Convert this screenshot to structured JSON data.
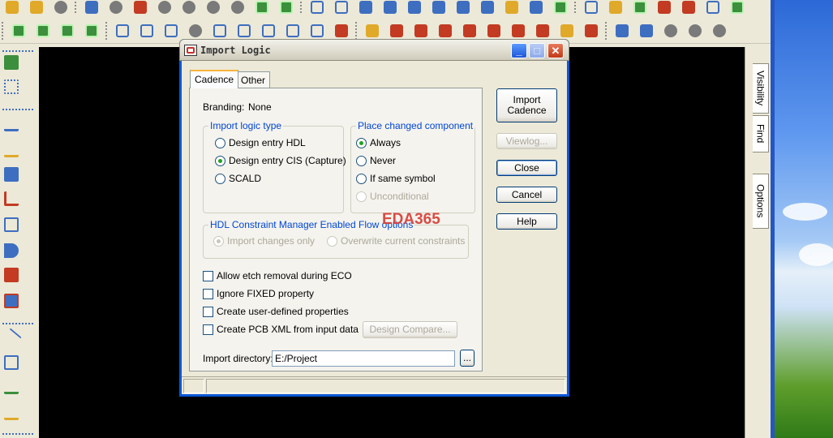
{
  "dialog": {
    "title": "Import Logic",
    "tabs": [
      "Cadence",
      "Other"
    ],
    "branding_label": "Branding:",
    "branding_value": "None",
    "import_logic_type": {
      "title": "Import logic type",
      "options": [
        "Design entry HDL",
        "Design entry CIS (Capture)",
        "SCALD"
      ],
      "selected": "Design entry CIS (Capture)"
    },
    "place_changed_component": {
      "title": "Place changed component",
      "options": [
        "Always",
        "Never",
        "If same symbol",
        "Unconditional"
      ],
      "selected": "Always"
    },
    "hdl_constraint": {
      "title": "HDL Constraint Manager Enabled Flow options",
      "options": [
        "Import changes only",
        "Overwrite current constraints"
      ]
    },
    "checkboxes": [
      "Allow etch removal during ECO",
      "Ignore FIXED property",
      "Create user-defined properties",
      "Create PCB XML from input data"
    ],
    "design_compare_button": "Design Compare...",
    "import_directory_label": "Import directory:",
    "import_directory_value": "E:/Project",
    "browse_button": "...",
    "buttons": {
      "import_cadence": "Import Cadence",
      "viewlog": "Viewlog...",
      "close": "Close",
      "cancel": "Cancel",
      "help": "Help"
    },
    "watermark": "EDA365"
  },
  "right_panel": {
    "tabs": [
      "Visibility",
      "Find",
      "Options"
    ]
  },
  "colors": {
    "title_bar_border": "#0a57d8",
    "group_title": "#0046d5",
    "canvas": "#000000"
  }
}
